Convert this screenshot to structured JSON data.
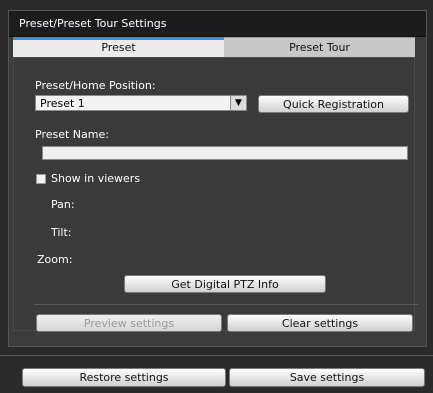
{
  "panel": {
    "title": "Preset/Preset Tour Settings"
  },
  "tabs": {
    "preset": "Preset",
    "preset_tour": "Preset Tour"
  },
  "preset": {
    "home_position_label": "Preset/Home Position:",
    "selected_value": "Preset 1",
    "quick_registration": "Quick Registration",
    "preset_name_label": "Preset Name:",
    "preset_name_value": "",
    "show_in_viewers_label": "Show in viewers",
    "show_in_viewers_checked": false,
    "pan_label": "Pan:",
    "tilt_label": "Tilt:",
    "zoom_label": "Zoom:",
    "get_ptz_info": "Get Digital PTZ Info",
    "preview_settings": "Preview settings",
    "clear_settings": "Clear settings"
  },
  "footer": {
    "restore_settings": "Restore settings",
    "save_settings": "Save settings"
  },
  "colors": {
    "active_tab_accent": "#3c8fc6",
    "panel_bg": "#3c3c3c",
    "title_bg": "#1c1c1c"
  }
}
